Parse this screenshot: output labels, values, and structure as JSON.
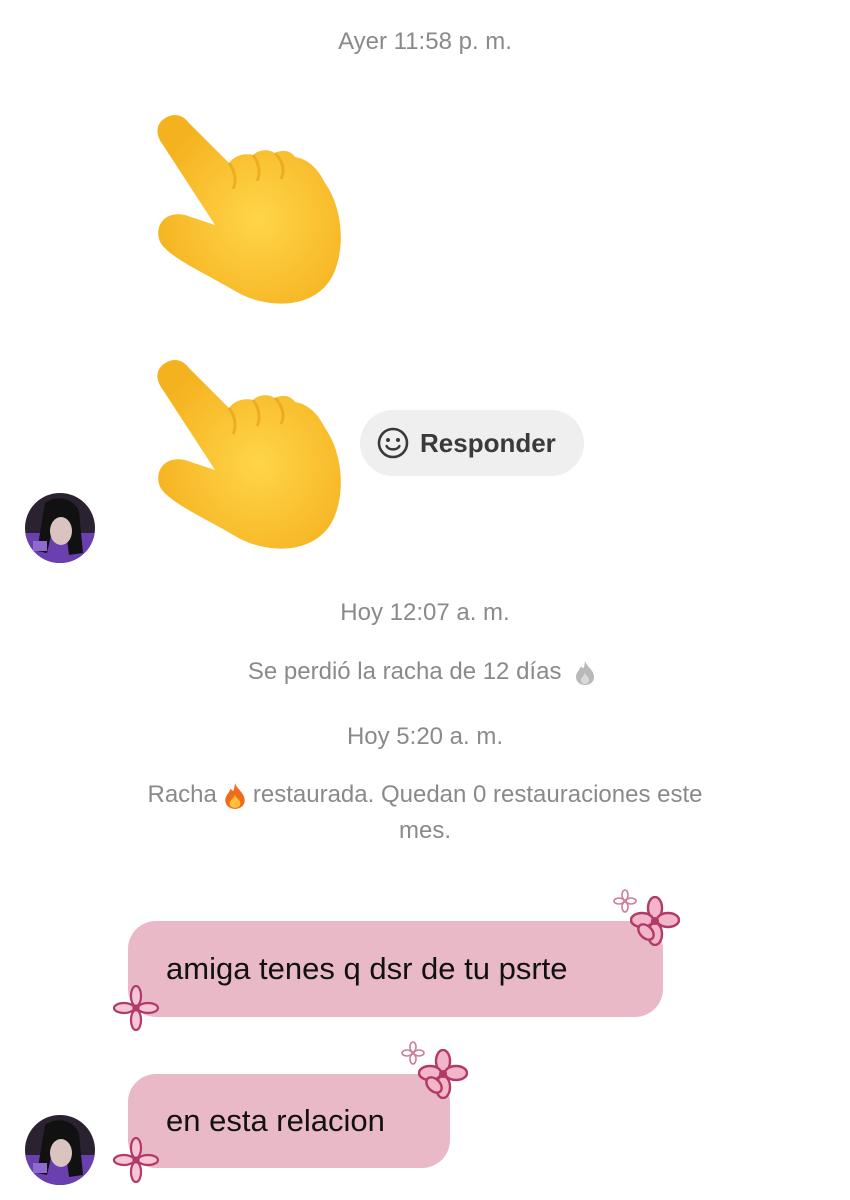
{
  "messages": {
    "timestamp_1": "Ayer 11:58 p. m.",
    "timestamp_2": "Hoy 12:07 a. m.",
    "streak_lost": "Se perdió la racha de 12 días",
    "timestamp_3": "Hoy 5:20 a. m.",
    "streak_restored_prefix": "Racha",
    "streak_restored_suffix_line1": "restaurada. Quedan 0 restauraciones este",
    "streak_restored_suffix_line2": "mes.",
    "bubble_1": "amiga tenes q dsr de tu psrte",
    "bubble_2": "en esta relacion"
  },
  "reply": {
    "label": "Responder",
    "icon": "smiley-icon"
  },
  "emoji": {
    "name": "pointing-hand-emoji"
  },
  "colors": {
    "bubble": "#e9b9c8",
    "flower": "#c0557c",
    "system_text": "#8a8a8a",
    "reply_bg": "#efefef"
  }
}
